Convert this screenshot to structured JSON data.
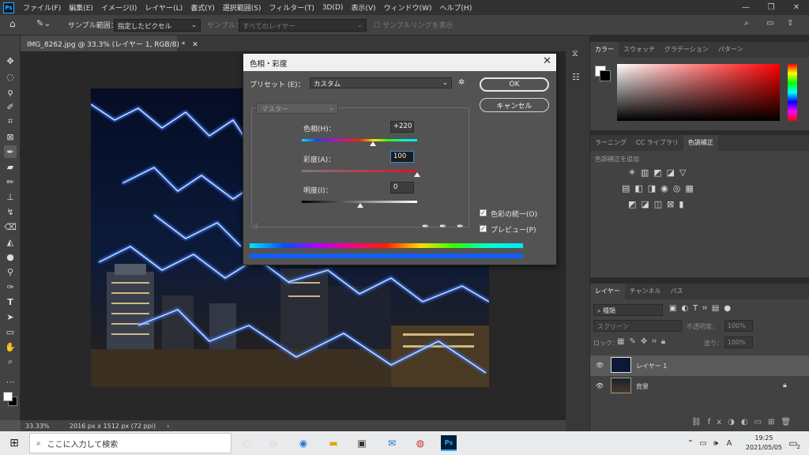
{
  "menubar": {
    "items": [
      "ファイル(F)",
      "編集(E)",
      "イメージ(I)",
      "レイヤー(L)",
      "書式(Y)",
      "選択範囲(S)",
      "フィルター(T)",
      "3D(D)",
      "表示(V)",
      "ウィンドウ(W)",
      "ヘルプ(H)"
    ],
    "logo": "Ps"
  },
  "options": {
    "sample_size_label": "サンプル範囲：",
    "sample_size_value": "指定したピクセル",
    "sample_label": "サンプル：",
    "sample_value": "すべてのレイヤー",
    "show_ring_label": "サンプルリングを表示"
  },
  "document": {
    "tab_title": "IMG_8262.jpg @ 33.3% (レイヤー 1, RGB/8) *",
    "zoom": "33.33%",
    "dimensions": "2016 px x 1512 px (72 ppi)"
  },
  "dialog": {
    "title": "色相・彩度",
    "preset_label": "プリセット (E)：",
    "preset_value": "カスタム",
    "ok_label": "OK",
    "cancel_label": "キャンセル",
    "channel_value": "マスター",
    "hue_label": "色相(H)：",
    "hue_value": "+220",
    "saturation_label": "彩度(A)：",
    "saturation_value": "100",
    "lightness_label": "明度(I)：",
    "lightness_value": "0",
    "colorize_label": "色彩の統一(O)",
    "preview_label": "プレビュー(P)",
    "colorize_checked": true,
    "preview_checked": true
  },
  "panels": {
    "color_tabs": [
      "カラー",
      "スウォッチ",
      "グラデーション",
      "パターン"
    ],
    "adjust_tabs": [
      "ラーニング",
      "CC ライブラリ",
      "色調補正"
    ],
    "adjust_hint": "色調補正を追加",
    "layer_tabs": [
      "レイヤー",
      "チャンネル",
      "パス"
    ],
    "layer_filter": "種類",
    "blend_mode": "スクリーン",
    "opacity_label": "不透明度：",
    "opacity_value": "100%",
    "lock_label": "ロック：",
    "fill_label": "塗り：",
    "fill_value": "100%",
    "layers": [
      {
        "name": "レイヤー 1",
        "selected": true
      },
      {
        "name": "背景",
        "selected": false
      }
    ]
  },
  "taskbar": {
    "search_placeholder": "ここに入力して検索",
    "time": "19:25",
    "date": "2021/05/05",
    "ime": "A",
    "notifications": "2"
  },
  "colors": {
    "accent": "#31a8ff",
    "hue_fill_top": "#00e0ff",
    "hue_fill_bottom": "#1060ff"
  }
}
